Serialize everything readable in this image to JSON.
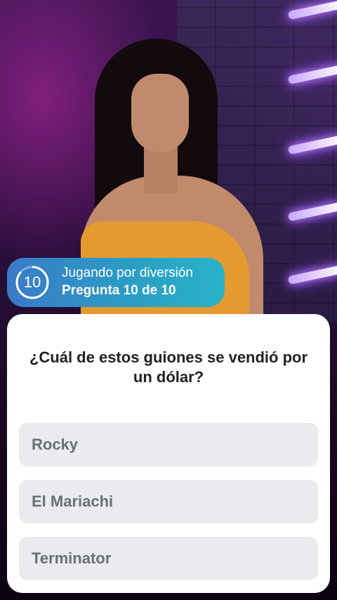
{
  "status": {
    "timer_value": "10",
    "mode_label": "Jugando por diversión",
    "question_progress": "Pregunta 10 de 10"
  },
  "question": {
    "text": "¿Cuál de estos guiones se vendió por un dólar?",
    "options": [
      {
        "label": "Rocky"
      },
      {
        "label": "El Mariachi"
      },
      {
        "label": "Terminator"
      }
    ]
  },
  "colors": {
    "pill_gradient_start": "#3a7ac9",
    "pill_gradient_end": "#29b3c6",
    "card_background": "#ffffff",
    "option_background": "#e9ebee",
    "option_text": "#6a6f76"
  }
}
